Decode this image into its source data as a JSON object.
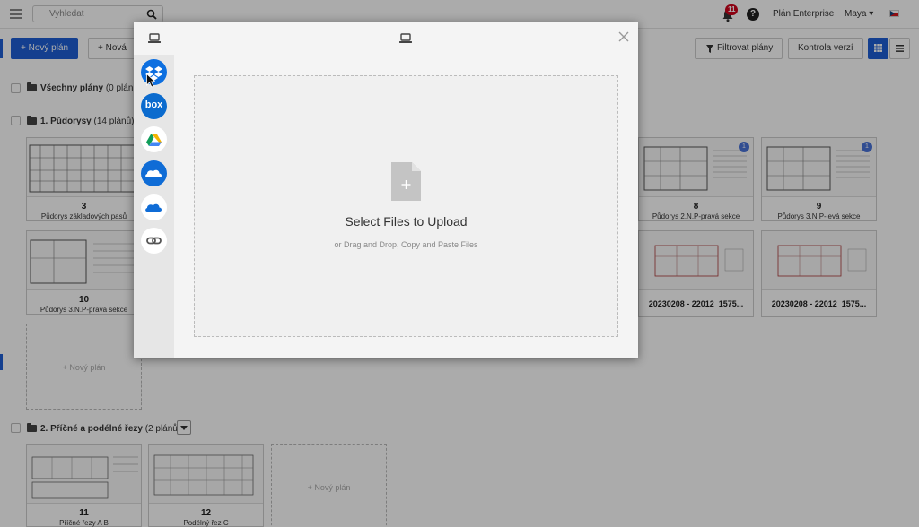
{
  "header": {
    "search_placeholder": "Vyhledat",
    "notification_count": "11",
    "help_label": "?",
    "plan_label": "Plán Enterprise",
    "user_label": "Maya",
    "language": "cs"
  },
  "toolbar": {
    "new_plan_label": "+ Nový plán",
    "new_folder_label": "+ Nová s",
    "filter_label": "Filtrovat plány",
    "version_check_label": "Kontrola verzí"
  },
  "folders": {
    "all": {
      "label": "Všechny plány",
      "count": "(0 plánů)"
    },
    "f1": {
      "label": "1. Půdorysy",
      "count": "(14 plánů)"
    },
    "f2": {
      "label": "2. Příčné a podélné řezy",
      "count": "(2 plánů)"
    }
  },
  "cards": {
    "c3": {
      "num": "3",
      "name": "Půdorys základových pasů"
    },
    "c8": {
      "num": "8",
      "name": "Půdorys 2.N.P-pravá sekce",
      "badge": "1"
    },
    "c9": {
      "num": "9",
      "name": "Půdorys 3.N.P-levá sekce",
      "badge": "1"
    },
    "c10": {
      "num": "10",
      "name": "Půdorys 3.N.P-pravá sekce"
    },
    "c_a": {
      "name": "20230208 - 22012_1575..."
    },
    "c_b": {
      "name": "20230208 - 22012_1575..."
    },
    "c11": {
      "num": "11",
      "name": "Příčné řezy A B"
    },
    "c12": {
      "num": "12",
      "name": "Podélný řez C"
    }
  },
  "new_plan_placeholder": "+ Nový plán",
  "upload": {
    "title": "Select Files to Upload",
    "subtitle": "or Drag and Drop, Copy and Paste Files",
    "sources": [
      "dropbox-icon",
      "box-icon",
      "google-drive-icon",
      "onedrive-icon",
      "onedrive-business-icon",
      "link-icon"
    ],
    "box_text": "box"
  },
  "colors": {
    "primary": "#1f5fd6",
    "dropbox": "#0d6fe0",
    "box": "#0b6bce",
    "onedrive": "#0f6cd6",
    "badge": "#d0021b"
  }
}
